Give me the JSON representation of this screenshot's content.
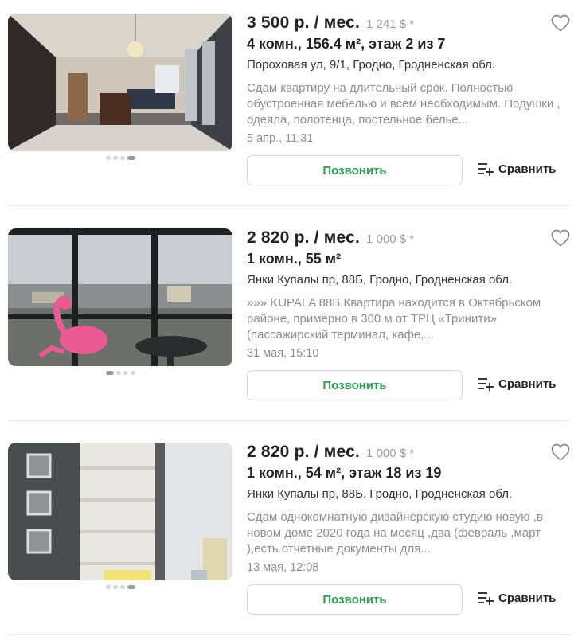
{
  "colors": {
    "accent_green": "#2e9e4f",
    "muted_text": "#8e8e8e",
    "divider": "#e7e7e7"
  },
  "icons": {
    "favorite": "heart-outline-icon",
    "compare": "compare-plus-icon"
  },
  "listings": [
    {
      "price": "3 500 р. / мес.",
      "price_usd": "1 241 $ *",
      "params": "4 комн., 156.4 м², этаж 2 из 7",
      "address": "Пороховая ул, 9/1, Гродно, Гродненская обл.",
      "description": "Сдам квартиру на длительный срок. Полностью обустроенная мебелью и всем необходимым. Подушки , одеяла, полотенца, постельное белье...",
      "date": "5 апр., 11:31",
      "call_label": "Позвонить",
      "compare_label": "Сравнить",
      "photo_count": 4,
      "active_photo": 4
    },
    {
      "price": "2 820 р. / мес.",
      "price_usd": "1 000 $ *",
      "params": "1 комн., 55 м²",
      "address": "Янки Купалы пр, 88Б, Гродно, Гродненская обл.",
      "description": "»»» KUPALA 88B Квартира находится в Октябрьском районе, примерно в 300 м от ТРЦ «Тринити» (пассажирский терминал, кафе,...",
      "date": "31 мая, 15:10",
      "call_label": "Позвонить",
      "compare_label": "Сравнить",
      "photo_count": 4,
      "active_photo": 1
    },
    {
      "price": "2 820 р. / мес.",
      "price_usd": "1 000 $ *",
      "params": "1 комн., 54 м², этаж 18 из 19",
      "address": "Янки Купалы пр, 88Б, Гродно, Гродненская обл.",
      "description": "Сдам однокомнатную дизайнерскую студию новую ,в новом доме 2020 года на месяц ,два (февраль ,март ),есть отчетные документы для...",
      "date": "13 мая, 12:08",
      "call_label": "Позвонить",
      "compare_label": "Сравнить",
      "photo_count": 4,
      "active_photo": 4
    }
  ]
}
